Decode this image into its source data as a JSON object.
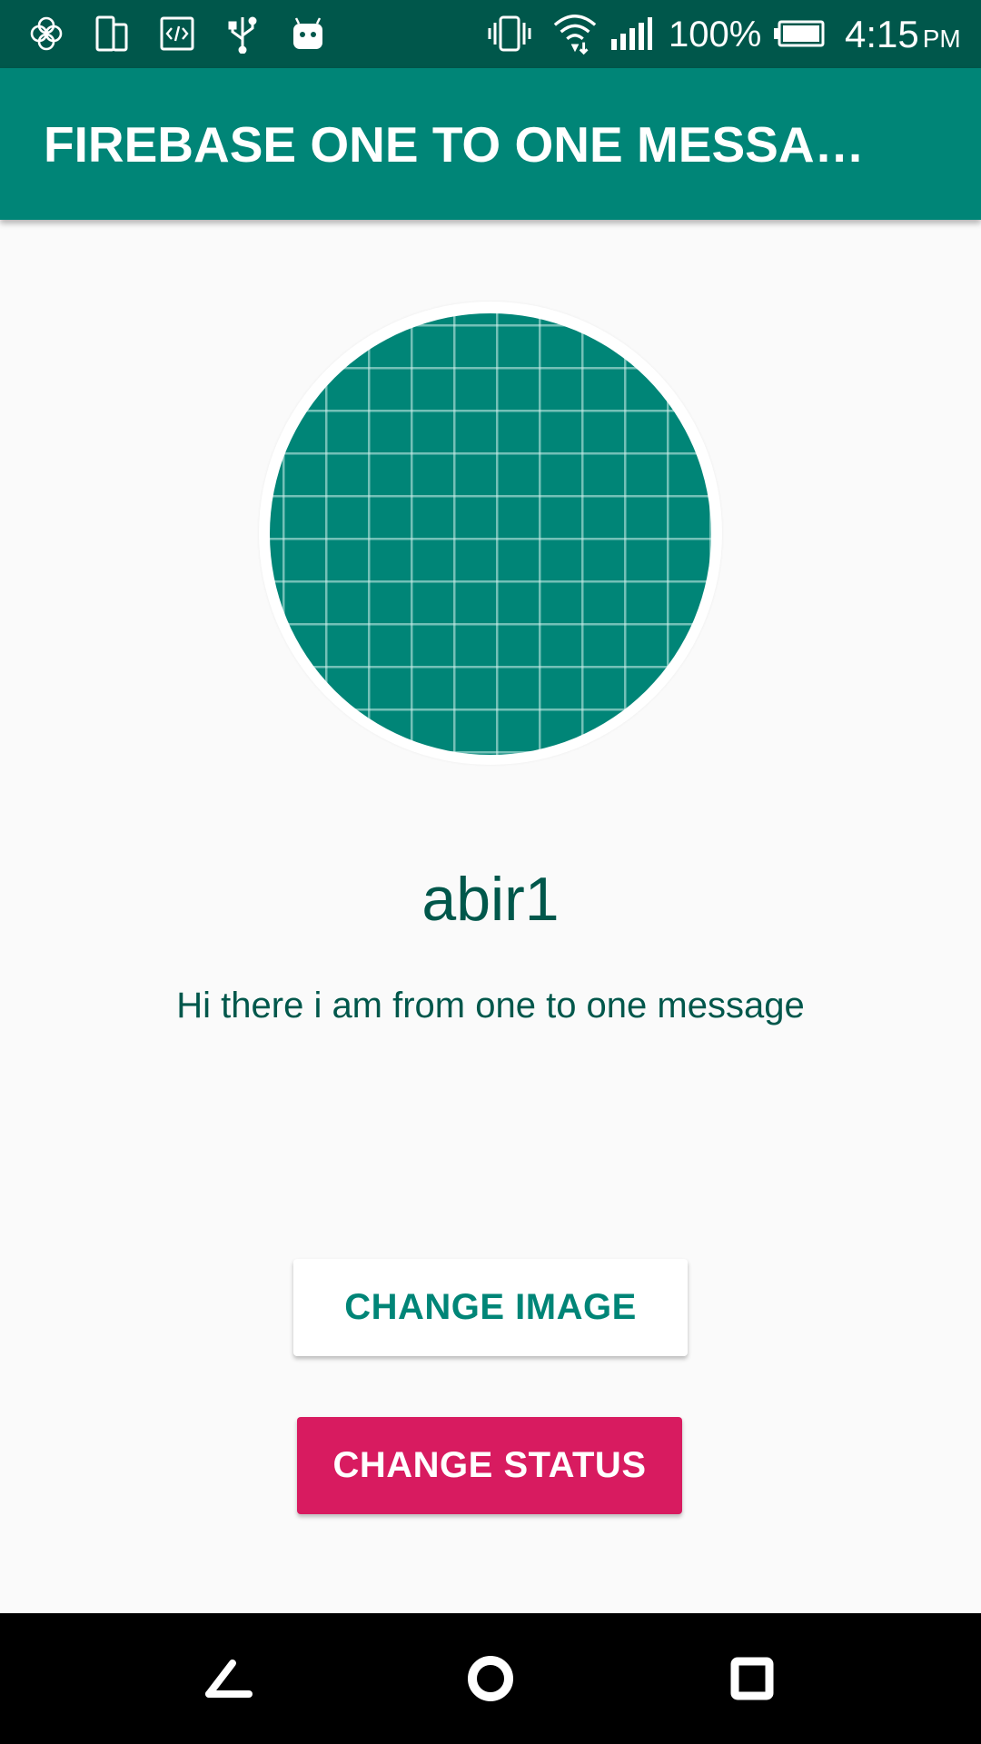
{
  "status_bar": {
    "battery_percent": "100%",
    "time": "4:15",
    "ampm": "PM",
    "icons": [
      "hexagons-icon",
      "devices-icon",
      "code-icon",
      "usb-icon",
      "android-icon",
      "vibrate-icon",
      "wifi-icon",
      "signal-icon",
      "battery-icon"
    ]
  },
  "app_bar": {
    "title": "FIREBASE ONE TO ONE MESSAGING"
  },
  "profile": {
    "username": "abir1",
    "status": "Hi there  i am from one to one message"
  },
  "buttons": {
    "change_image": "CHANGE IMAGE",
    "change_status": "CHANGE STATUS"
  },
  "nav_bar": {
    "icons": [
      "back-icon",
      "home-icon",
      "recents-icon"
    ]
  },
  "colors": {
    "status_bar": "#00574b",
    "primary": "#008577",
    "accent": "#d81b60",
    "background": "#fafafa",
    "text_dark_teal": "#00574b"
  }
}
